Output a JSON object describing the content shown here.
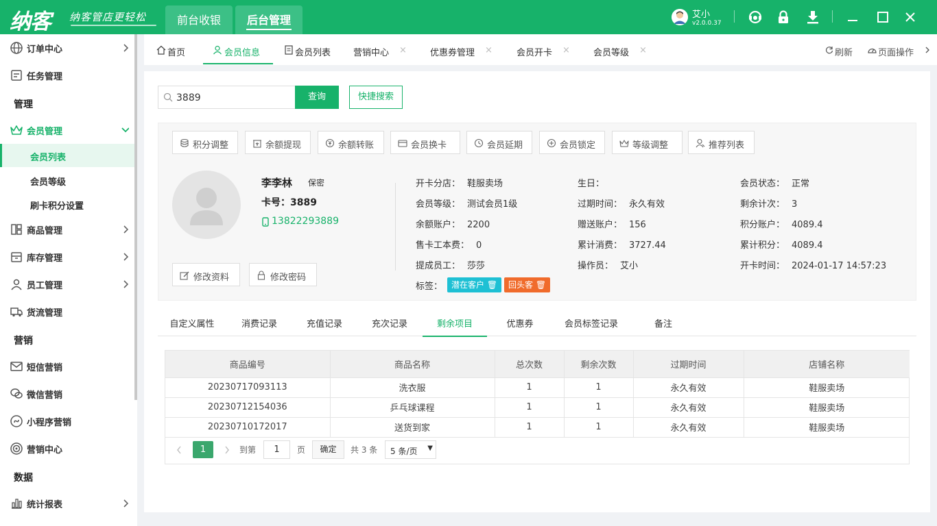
{
  "app": {
    "logo": "纳客",
    "slogan": "纳客管店更轻松",
    "tabs": [
      "前台收银",
      "后台管理"
    ],
    "user": {
      "name": "艾小",
      "version": "v2.0.0.37"
    },
    "accent": "#17b26a"
  },
  "sidebar": {
    "items": {
      "order": "订单中心",
      "task": "任务管理",
      "member": "会员管理",
      "goods": "商品管理",
      "stock": "库存管理",
      "staff": "员工管理",
      "logistics": "货流管理",
      "sms": "短信营销",
      "wechat": "微信营销",
      "miniapp": "小程序营销",
      "marketing": "营销中心",
      "report": "统计报表"
    },
    "groups": {
      "manage": "管理",
      "marketing": "营销",
      "data": "数据"
    },
    "member_sub": [
      "会员列表",
      "会员等级",
      "刷卡积分设置"
    ]
  },
  "tabs_bar": {
    "tabs": [
      "首页",
      "会员信息",
      "会员列表",
      "营销中心",
      "优惠券管理",
      "会员开卡",
      "会员等级"
    ],
    "refresh": "刷新",
    "page_ops": "页面操作"
  },
  "search": {
    "value": "3889",
    "query_btn": "查询",
    "quick_btn": "快捷搜索"
  },
  "actions": [
    "积分调整",
    "余额提现",
    "余额转账",
    "会员换卡",
    "会员延期",
    "会员锁定",
    "等级调整",
    "推荐列表"
  ],
  "member": {
    "name": "李李林",
    "gender": "保密",
    "card": "卡号：3889",
    "phone": "13822293889",
    "edit_btn": "修改资料",
    "pwd_btn": "修改密码",
    "info": [
      {
        "k": "开卡分店：",
        "v": "鞋服卖场"
      },
      {
        "k": "生日：",
        "v": ""
      },
      {
        "k": "会员状态：",
        "v": "正常"
      },
      {
        "k": "会员等级：",
        "v": "测试会员1级"
      },
      {
        "k": "过期时间：",
        "v": "永久有效"
      },
      {
        "k": "剩余计次：",
        "v": "3"
      },
      {
        "k": "余额账户：",
        "v": "2200"
      },
      {
        "k": "赠送账户：",
        "v": "156"
      },
      {
        "k": "积分账户：",
        "v": "4089.4"
      },
      {
        "k": "售卡工本费：",
        "v": "0"
      },
      {
        "k": "累计消费：",
        "v": "3727.44"
      },
      {
        "k": "累计积分：",
        "v": "4089.4"
      },
      {
        "k": "提成员工：",
        "v": "莎莎"
      },
      {
        "k": "操作员：",
        "v": "艾小"
      },
      {
        "k": "开卡时间：",
        "v": "2024-01-17 14:57:23"
      }
    ],
    "tags_label": "标签：",
    "tags": [
      {
        "text": "潜在客户",
        "color": "#1ec0d4"
      },
      {
        "text": "回头客",
        "color": "#f06b2b"
      }
    ]
  },
  "subtabs": [
    "自定义属性",
    "消费记录",
    "充值记录",
    "充次记录",
    "剩余项目",
    "优惠券",
    "会员标签记录",
    "备注"
  ],
  "table": {
    "headers": [
      "商品编号",
      "商品名称",
      "总次数",
      "剩余次数",
      "过期时间",
      "店铺名称"
    ],
    "rows": [
      [
        "20230717093113",
        "洗衣服",
        "1",
        "1",
        "永久有效",
        "鞋服卖场"
      ],
      [
        "20230712154036",
        "乒乓球课程",
        "1",
        "1",
        "永久有效",
        "鞋服卖场"
      ],
      [
        "20230710172017",
        "送货到家",
        "1",
        "1",
        "永久有效",
        "鞋服卖场"
      ]
    ]
  },
  "pager": {
    "current": "1",
    "goto_label": "到第",
    "goto_value": "1",
    "page_unit": "页",
    "confirm": "确定",
    "total": "共 3 条",
    "page_size": "5 条/页"
  }
}
